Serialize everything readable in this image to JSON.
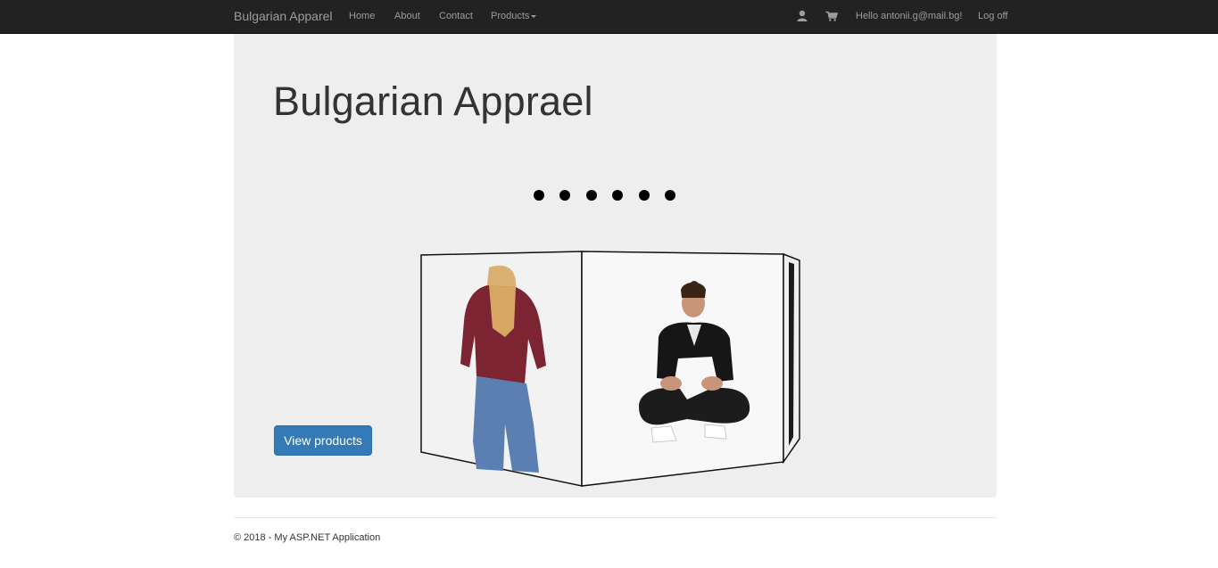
{
  "navbar": {
    "brand": "Bulgarian Apparel",
    "links": [
      "Home",
      "About",
      "Contact",
      "Products"
    ],
    "user_icon": "user-icon",
    "cart_icon": "shopping-cart-icon",
    "greeting": "Hello antonii.g@mail.bg!",
    "logoff": "Log off"
  },
  "jumbotron": {
    "title": "Bulgarian Apprael",
    "carousel_dot_count": 6,
    "button_label": "View products"
  },
  "footer": {
    "copyright": "© 2018 - My ASP.NET Application"
  },
  "colors": {
    "navbar_bg": "#222222",
    "nav_text": "#9d9d9d",
    "jumbotron_bg": "#eeeeee",
    "primary": "#337ab7"
  }
}
